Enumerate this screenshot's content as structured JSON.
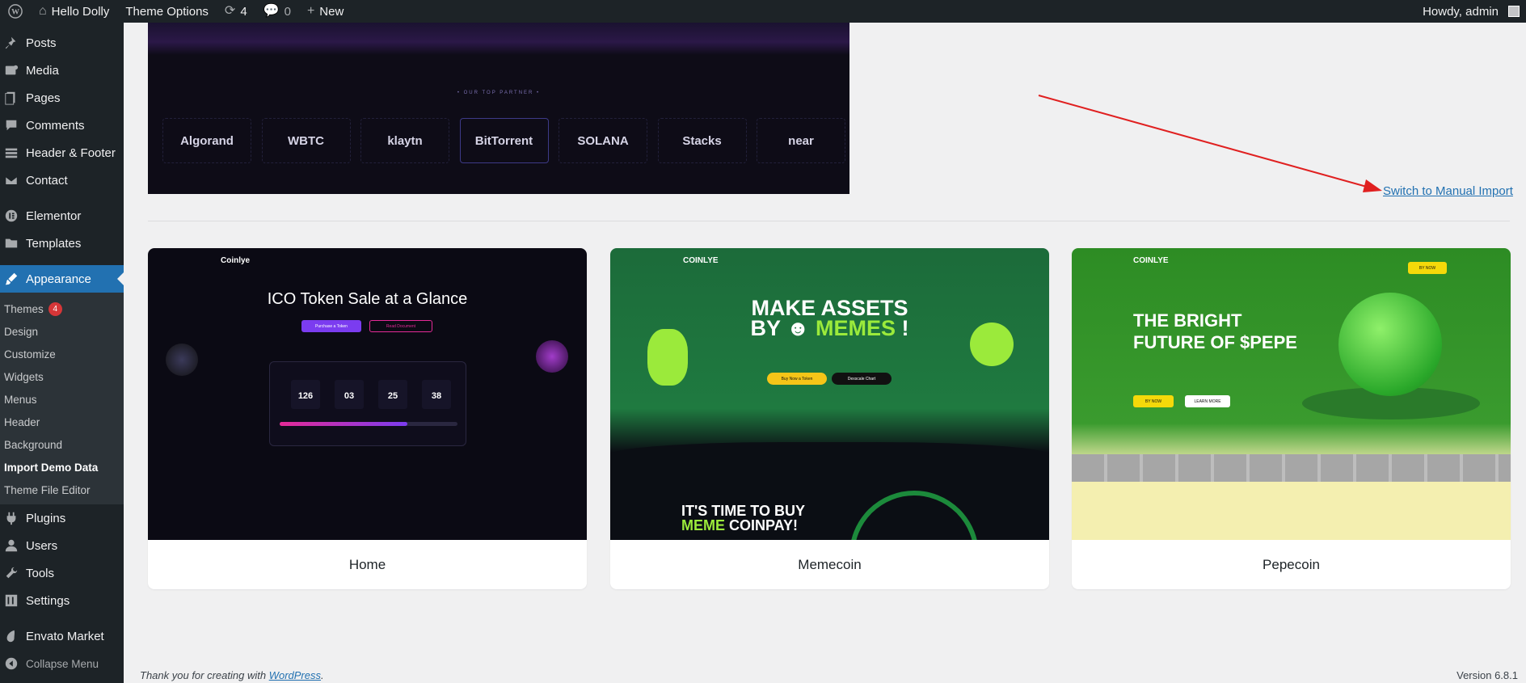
{
  "admin_bar": {
    "site_name": "Hello Dolly",
    "theme_options": "Theme Options",
    "updates_count": "4",
    "comments_count": "0",
    "new_label": "New",
    "greeting": "Howdy, admin"
  },
  "sidebar": {
    "items": [
      {
        "label": "Posts",
        "icon": "pin-icon"
      },
      {
        "label": "Media",
        "icon": "media-icon"
      },
      {
        "label": "Pages",
        "icon": "pages-icon"
      },
      {
        "label": "Comments",
        "icon": "comment-icon"
      },
      {
        "label": "Header & Footer",
        "icon": "header-footer-icon"
      },
      {
        "label": "Contact",
        "icon": "mail-icon"
      },
      {
        "label": "Elementor",
        "icon": "elementor-icon"
      },
      {
        "label": "Templates",
        "icon": "folder-icon"
      },
      {
        "label": "Appearance",
        "icon": "brush-icon"
      }
    ],
    "submenu": [
      {
        "label": "Themes",
        "badge": "4"
      },
      {
        "label": "Design"
      },
      {
        "label": "Customize"
      },
      {
        "label": "Widgets"
      },
      {
        "label": "Menus"
      },
      {
        "label": "Header"
      },
      {
        "label": "Background"
      },
      {
        "label": "Import Demo Data"
      },
      {
        "label": "Theme File Editor"
      }
    ],
    "items_bottom": [
      {
        "label": "Plugins",
        "icon": "plugin-icon"
      },
      {
        "label": "Users",
        "icon": "users-icon"
      },
      {
        "label": "Tools",
        "icon": "tools-icon"
      },
      {
        "label": "Settings",
        "icon": "settings-icon"
      },
      {
        "label": "Envato Market",
        "icon": "envato-icon"
      }
    ],
    "collapse_label": "Collapse Menu",
    "accent": "#2271b1"
  },
  "top_preview": {
    "partner_label": "• OUR TOP PARTNER •",
    "logos": [
      "Algorand",
      "WBTC",
      "klaytn",
      "BitTorrent",
      "SOLANA",
      "Stacks",
      "near"
    ]
  },
  "switch_link": "Switch to Manual Import",
  "cards": [
    {
      "label": "Home",
      "brand": "Coinlye",
      "headline": "ICO Token Sale at a Glance",
      "btn1": "Purchase a Token",
      "btn2": "Read Document",
      "countdown": [
        "126",
        "03",
        "25",
        "38"
      ],
      "progress": 0.72
    },
    {
      "label": "Memecoin",
      "brand": "COINLYE",
      "headline_1": "MAKE ASSETS",
      "headline_2a": "BY",
      "headline_2b": "MEMES",
      "btn1": "Buy Now a Token",
      "btn2": "Dexscale Chart",
      "sub_1": "IT'S TIME TO BUY",
      "sub_2a": "MEME",
      "sub_2b": "COINPAY!"
    },
    {
      "label": "Pepecoin",
      "brand": "COINLYE",
      "headline_1": "THE BRIGHT",
      "headline_2": "FUTURE OF $PEPE",
      "btn1": "BY NOW",
      "btn2": "LEARN MORE",
      "cta": "BY NOW"
    }
  ],
  "footer": {
    "thanks_prefix": "Thank you for creating with",
    "wordpress": "WordPress",
    "version": "Version 6.8.1"
  },
  "colors": {
    "admin_bg": "#1d2327",
    "link": "#2271b1",
    "arrow": "#e02020"
  }
}
